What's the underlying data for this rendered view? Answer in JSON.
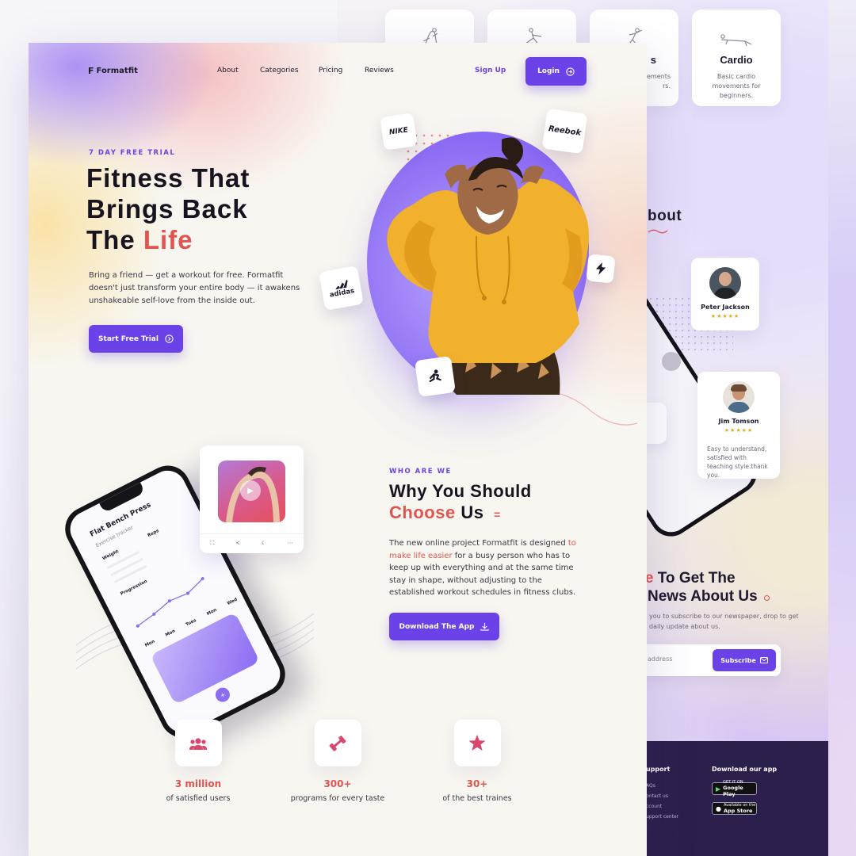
{
  "brand": {
    "name": "Formatfit",
    "mark": "F"
  },
  "nav": {
    "links": [
      "About",
      "Categories",
      "Pricing",
      "Reviews"
    ],
    "signup": "Sign Up",
    "login": "Login"
  },
  "hero": {
    "eyebrow": "7 DAY FREE TRIAL",
    "title_line1": "Fitness That",
    "title_line2": "Brings Back",
    "title_line3_prefix": "The",
    "title_line3_accent": "Life",
    "description": "Bring a friend — get a workout for free. Formatfit doesn't just transform your entire body — it awakens unshakeable self-love from the inside out.",
    "cta": "Start Free Trial",
    "brand_tiles": [
      "NIKE",
      "Reebok",
      "adidas"
    ]
  },
  "why": {
    "eyebrow": "WHO ARE WE",
    "title_line1": "Why You Should",
    "title_accent": "Choose",
    "title_rest": "Us",
    "desc_before": "The new online project Formatfit is designed ",
    "desc_highlight": "to make life easier",
    "desc_after": " for a busy person who has to keep up with everything and at the same time stay in shape, without adjusting to the established workout schedules in fitness clubs.",
    "cta": "Download The App"
  },
  "phone": {
    "title": "Flat Bench Press",
    "subtitle": "Exercise tracker",
    "col_weight": "Weight",
    "col_reps": "Reps",
    "section": "Progression",
    "days": [
      "Mon",
      "Mon",
      "Tues",
      "Mon",
      "Wed"
    ]
  },
  "stats": [
    {
      "value": "3 million",
      "label": "of satisfied users"
    },
    {
      "value": "300+",
      "label": "programs for every taste"
    },
    {
      "value": "30+",
      "label": "of the best traines"
    }
  ],
  "back": {
    "categories": [
      {
        "title": "",
        "desc": ""
      },
      {
        "title": "",
        "desc": ""
      },
      {
        "title": "s",
        "desc": "ovements\nrs."
      },
      {
        "title": "Cardio",
        "desc": "Basic cardio movements for beginners."
      }
    ],
    "about_heading": "bout",
    "reviews": [
      {
        "name": "Peter Jackson",
        "stars": "★★★★★",
        "text": ""
      },
      {
        "name": "Jim Tomson",
        "stars": "★★★★★",
        "text": "Easy to understand, satisfied with teaching style.thank you."
      }
    ],
    "subscribe": {
      "title_accent": "ibe",
      "title_line1_rest": " To Get The",
      "title_line2": "News About Us",
      "desc": "you to subscribe to our newspaper, drop to get daily update about us.",
      "placeholder": "address",
      "button": "Subscribe"
    },
    "footer": {
      "support_title": "upport",
      "support_links": [
        "AQs",
        "ontact us",
        "ccount",
        "upport center"
      ],
      "download_title": "Download our app",
      "google_small": "GET IT ON",
      "google_big": "Google Play",
      "apple_small": "Available on the",
      "apple_big": "App Store"
    }
  },
  "colors": {
    "accent": "#6a42e8",
    "highlight": "#e0554f",
    "footer_bg": "#2d1f4b"
  }
}
